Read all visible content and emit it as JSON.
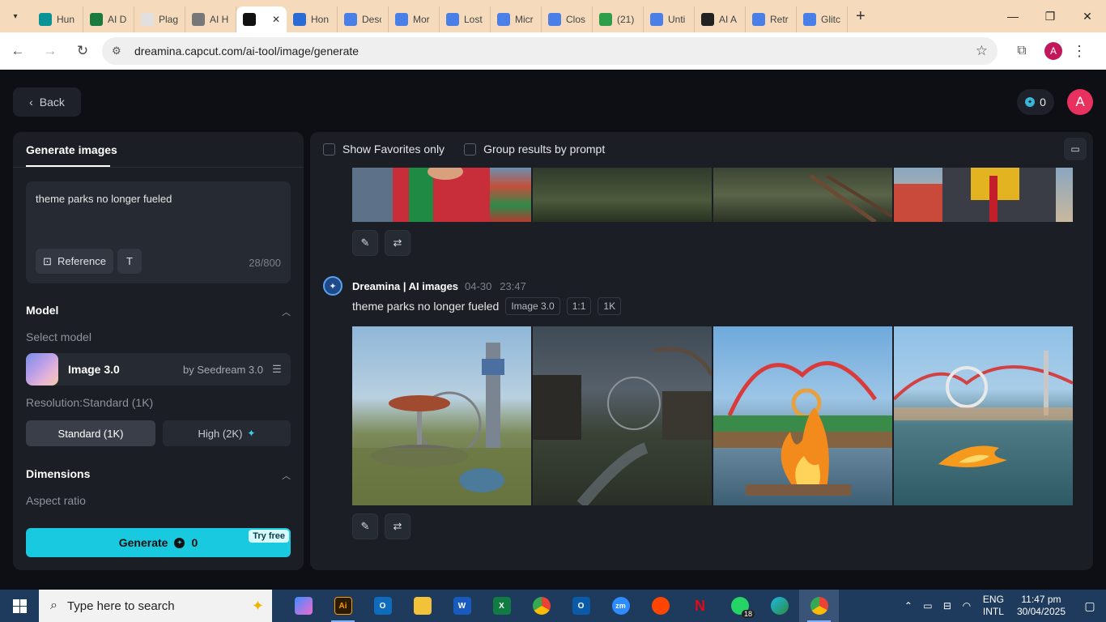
{
  "browser": {
    "tabs": [
      {
        "label": "Hun",
        "color": "#0a9396"
      },
      {
        "label": "AI D",
        "color": "#1b7a3e"
      },
      {
        "label": "Plag",
        "color": "#e0e0e0"
      },
      {
        "label": "AI H",
        "color": "#777777"
      },
      {
        "label": "",
        "color": "#111111",
        "active": true
      },
      {
        "label": "Hon",
        "color": "#2b6cd4"
      },
      {
        "label": "Desc",
        "color": "#4a7fe8"
      },
      {
        "label": "Mor",
        "color": "#4a7fe8"
      },
      {
        "label": "Lost",
        "color": "#4a7fe8"
      },
      {
        "label": "Micr",
        "color": "#4a7fe8"
      },
      {
        "label": "Clos",
        "color": "#4a7fe8"
      },
      {
        "label": "(21)",
        "color": "#2e9e4a"
      },
      {
        "label": "Unti",
        "color": "#4a7fe8"
      },
      {
        "label": "AI A",
        "color": "#222222"
      },
      {
        "label": "Retr",
        "color": "#4a7fe8"
      },
      {
        "label": "Glitc",
        "color": "#4a7fe8"
      }
    ],
    "url": "dreamina.capcut.com/ai-tool/image/generate",
    "profile_initial": "A"
  },
  "app": {
    "back_label": "Back",
    "credits": "0",
    "avatar_initial": "A",
    "left_panel": {
      "tab_label": "Generate images",
      "prompt": "theme parks no longer fueled",
      "reference_label": "Reference",
      "char_count": "28/800",
      "model_section": "Model",
      "select_model_label": "Select model",
      "model_name": "Image 3.0",
      "model_by": "by Seedream 3.0",
      "resolution_label": "Resolution:Standard (1K)",
      "res_standard": "Standard (1K)",
      "res_high": "High (2K)",
      "dimensions_section": "Dimensions",
      "aspect_ratio_label": "Aspect ratio",
      "generate_label": "Generate",
      "generate_cost": "0",
      "try_free": "Try free"
    },
    "right_panel": {
      "show_favorites": "Show Favorites only",
      "group_by_prompt": "Group results by prompt",
      "generation": {
        "author": "Dreamina | AI images",
        "date": "04-30",
        "time": "23:47",
        "prompt": "theme parks no longer fueled",
        "tags": [
          "Image 3.0",
          "1:1",
          "1K"
        ]
      }
    }
  },
  "taskbar": {
    "search_placeholder": "Type here to search",
    "whatsapp_badge": "18",
    "lang_top": "ENG",
    "lang_bottom": "INTL",
    "time": "11:47 pm",
    "date": "30/04/2025"
  }
}
